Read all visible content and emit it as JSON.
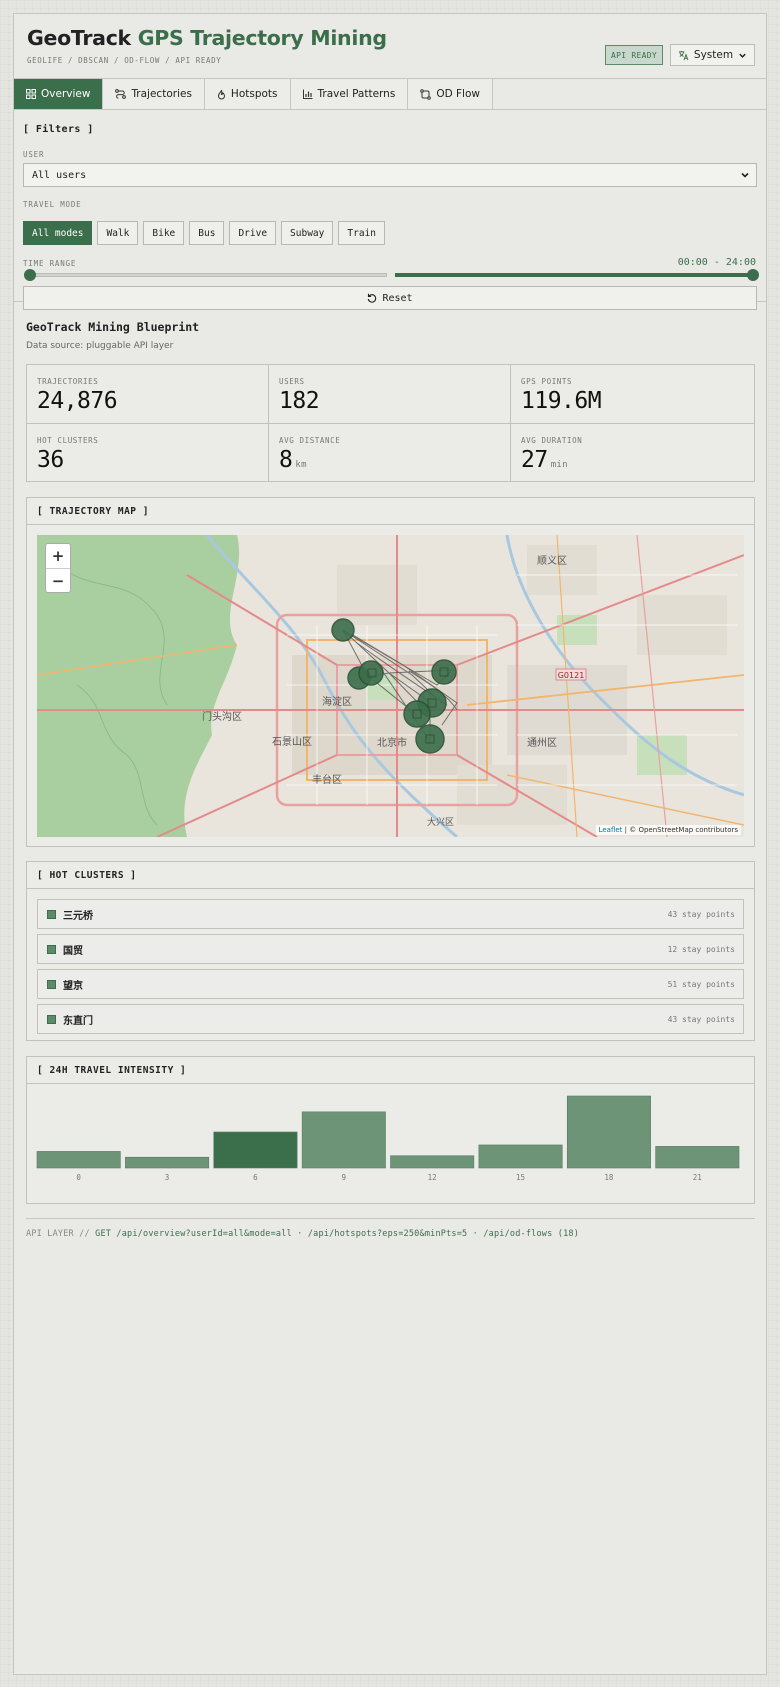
{
  "header": {
    "title_main": "GeoTrack",
    "title_accent": "GPS Trajectory Mining",
    "subtitle": "GEOLIFE / DBSCAN / OD-FLOW / API READY",
    "api_badge": "API READY",
    "system_label": "System"
  },
  "tabs": [
    {
      "label": "Overview",
      "icon": "grid-icon",
      "active": true
    },
    {
      "label": "Trajectories",
      "icon": "route-icon"
    },
    {
      "label": "Hotspots",
      "icon": "flame-icon"
    },
    {
      "label": "Travel Patterns",
      "icon": "bar-chart-icon"
    },
    {
      "label": "OD Flow",
      "icon": "swap-icon"
    }
  ],
  "filters": {
    "title": "[ Filters ]",
    "user_label": "USER",
    "user_value": "All users",
    "mode_label": "TRAVEL MODE",
    "modes": [
      "All modes",
      "Walk",
      "Bike",
      "Bus",
      "Drive",
      "Subway",
      "Train"
    ],
    "active_mode": "All modes",
    "time_label": "TIME RANGE",
    "time_value": "00:00 - 24:00",
    "reset_label": "Reset"
  },
  "blueprint": {
    "title": "GeoTrack Mining Blueprint",
    "source": "Data source: pluggable API layer"
  },
  "stats": [
    {
      "label": "TRAJECTORIES",
      "value": "24,876",
      "unit": ""
    },
    {
      "label": "USERS",
      "value": "182",
      "unit": ""
    },
    {
      "label": "GPS POINTS",
      "value": "119.6M",
      "unit": ""
    },
    {
      "label": "HOT CLUSTERS",
      "value": "36",
      "unit": ""
    },
    {
      "label": "AVG DISTANCE",
      "value": "8",
      "unit": "km"
    },
    {
      "label": "AVG DURATION",
      "value": "27",
      "unit": "min"
    }
  ],
  "map": {
    "title": "[ TRAJECTORY MAP ]",
    "zoom_in": "+",
    "zoom_out": "−",
    "attribution_leaflet": "Leaflet",
    "attribution_osm": "| © OpenStreetMap contributors",
    "places": [
      "顺义区",
      "海淀区",
      "北京市",
      "通州区",
      "门头沟区",
      "石景山区",
      "丰台区",
      "大兴区"
    ],
    "road_label": "G0121"
  },
  "clusters": {
    "title": "[ HOT CLUSTERS ]",
    "items": [
      {
        "name": "三元桥",
        "points": "43 stay points"
      },
      {
        "name": "国贸",
        "points": "12 stay points"
      },
      {
        "name": "望京",
        "points": "51 stay points"
      },
      {
        "name": "东直门",
        "points": "43 stay points"
      }
    ]
  },
  "intensity": {
    "title": "[ 24H TRAVEL INTENSITY ]"
  },
  "chart_data": {
    "type": "bar",
    "title": "24H TRAVEL INTENSITY",
    "categories": [
      "0",
      "3",
      "6",
      "9",
      "12",
      "15",
      "18",
      "21"
    ],
    "values": [
      23,
      15,
      50,
      78,
      17,
      32,
      100,
      30
    ],
    "highlight_index": 2,
    "ylim": [
      0,
      100
    ],
    "colors": {
      "bar": "#6e9478",
      "highlight": "#3b6e4b"
    }
  },
  "footer": {
    "prefix": "API LAYER //",
    "text": "GET /api/overview?userId=all&mode=all · /api/hotspots?eps=250&minPts=5 · /api/od-flows (18)"
  },
  "colors": {
    "accent": "#3b6e4b",
    "background": "#e9e9e6"
  }
}
